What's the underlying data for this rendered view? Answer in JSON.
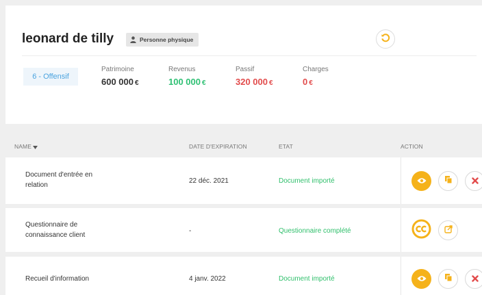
{
  "client": {
    "name": "leonard de tilly",
    "type_badge": "Personne physique"
  },
  "profile": {
    "label": "6 - Offensif"
  },
  "stats": [
    {
      "label": "Patrimoine",
      "value": "600 000",
      "currency": "€",
      "color": "#333333"
    },
    {
      "label": "Revenus",
      "value": "100 000",
      "currency": "€",
      "color": "#2fc074"
    },
    {
      "label": "Passif",
      "value": "320 000",
      "currency": "€",
      "color": "#e24b4b"
    },
    {
      "label": "Charges",
      "value": "0",
      "currency": "€",
      "color": "#e24b4b"
    }
  ],
  "table": {
    "columns": {
      "name": "NAME",
      "expiry": "DATE D'EXPIRATION",
      "state": "ETAT",
      "action": "ACTION"
    },
    "rows": [
      {
        "name_line1": "Document d'entrée en",
        "name_line2": "relation",
        "date": "22 déc. 2021",
        "state": "Document importé",
        "actions": [
          "view-icon",
          "copy-icon",
          "delete-icon"
        ]
      },
      {
        "name_line1": "Questionnaire de",
        "name_line2": "connaissance client",
        "date": "-",
        "state": "Questionnaire complété",
        "actions": [
          "cc-icon",
          "external-link-icon"
        ]
      },
      {
        "name_line1": "Recueil d'information",
        "name_line2": "",
        "date": "4 janv. 2022",
        "state": "Document importé",
        "actions": [
          "view-icon",
          "copy-icon",
          "delete-icon"
        ]
      }
    ]
  },
  "colors": {
    "accent": "#f5b21a",
    "positive": "#2fc074",
    "negative": "#e24b4b",
    "profile": "#4aa3df"
  }
}
